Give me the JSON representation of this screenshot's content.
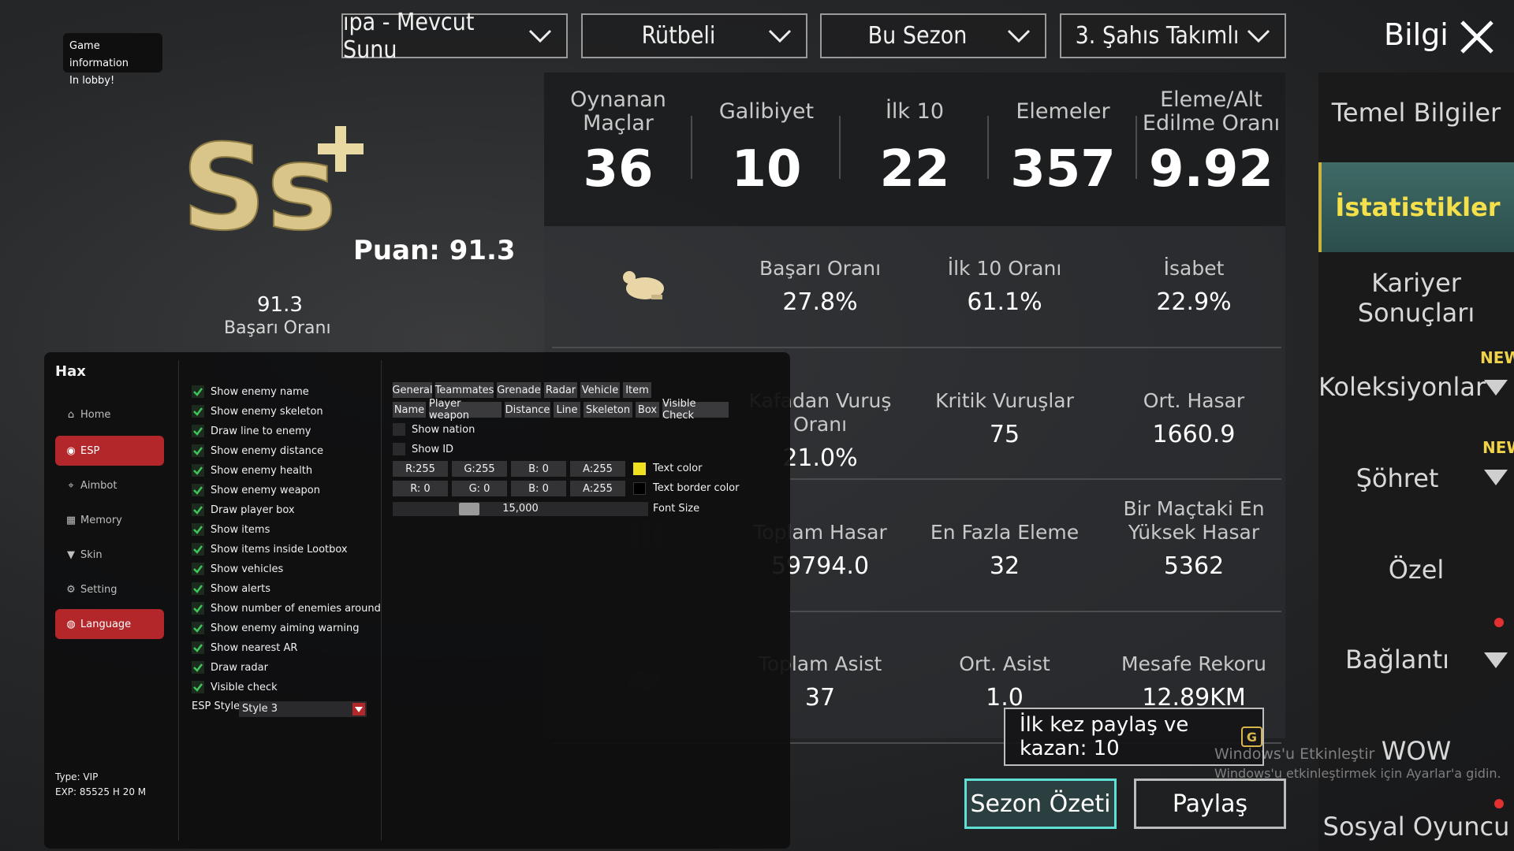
{
  "game_info": {
    "line1": "Game information",
    "line2": "In lobby!"
  },
  "dropdowns": [
    {
      "label": "ıpa - Mevcut Sunu"
    },
    {
      "label": "Rütbeli"
    },
    {
      "label": "Bu Sezon"
    },
    {
      "label": "3. Şahıs Takımlı"
    }
  ],
  "header": {
    "title": "Bilgi"
  },
  "rank": {
    "logo_text": "Ss",
    "puan": "Puan: 91.3",
    "rating_value": "91.3",
    "rating_label": "Başarı Oranı"
  },
  "top_stats": [
    {
      "label": "Oynanan Maçlar",
      "value": "36"
    },
    {
      "label": "Galibiyet",
      "value": "10"
    },
    {
      "label": "İlk 10",
      "value": "22"
    },
    {
      "label": "Elemeler",
      "value": "357"
    },
    {
      "label": "Eleme/Alt Edilme Oranı",
      "value": "9.92"
    }
  ],
  "detail_stats": [
    {
      "label": "Başarı Oranı",
      "value": "27.8%"
    },
    {
      "label": "İlk 10 Oranı",
      "value": "61.1%"
    },
    {
      "label": "İsabet",
      "value": "22.9%"
    },
    {
      "label": "Kafadan Vuruş Oranı",
      "value": "21.0%"
    },
    {
      "label": "Kritik Vuruşlar",
      "value": "75"
    },
    {
      "label": "Ort. Hasar",
      "value": "1660.9"
    },
    {
      "label": "Toplam Hasar",
      "value": "59794.0"
    },
    {
      "label": "En Fazla Eleme",
      "value": "32"
    },
    {
      "label": "Bir Maçtaki En Yüksek Hasar",
      "value": "5362"
    },
    {
      "label": "Toplam Asist",
      "value": "37"
    },
    {
      "label": "Ort. Asist",
      "value": "1.0"
    },
    {
      "label": "Mesafe Rekoru",
      "value": "12.89KM"
    }
  ],
  "sidebar": {
    "items": [
      {
        "label": "Temel Bilgiler"
      },
      {
        "label": "İstatistikler"
      },
      {
        "label": "Kariyer Sonuçları"
      },
      {
        "label": "Koleksiyonlar"
      },
      {
        "label": "Şöhret"
      },
      {
        "label": "Özel"
      },
      {
        "label": "Bağlantı"
      },
      {
        "label": "WOW"
      },
      {
        "label": "Sosyal Oyuncu"
      }
    ],
    "new_badge": "NEW"
  },
  "share": {
    "tip": "İlk kez paylaş ve kazan: 10",
    "coin": "G",
    "season_button": "Sezon Özeti",
    "share_button": "Paylaş"
  },
  "watermark": {
    "line1": "Windows'u Etkinleştir",
    "line2": "Windows'u etkinleştirmek için Ayarlar'a gidin."
  },
  "hax": {
    "title": "Hax",
    "nav": [
      {
        "label": "Home",
        "icon": "home-icon"
      },
      {
        "label": "ESP",
        "icon": "eye-icon"
      },
      {
        "label": "Aimbot",
        "icon": "crosshair-icon"
      },
      {
        "label": "Memory",
        "icon": "memory-icon"
      },
      {
        "label": "Skin",
        "icon": "shirt-icon"
      },
      {
        "label": "Setting",
        "icon": "gear-icon"
      },
      {
        "label": "Language",
        "icon": "globe-icon"
      }
    ],
    "footer": {
      "type": "Type: VIP",
      "exp": "EXP: 85525 H 20 M"
    },
    "options": [
      "Show enemy name",
      "Show enemy skeleton",
      "Draw line to enemy",
      "Show enemy distance",
      "Show enemy health",
      "Show enemy weapon",
      "Draw player box",
      "Show items",
      "Show items inside Lootbox",
      "Show vehicles",
      "Show alerts",
      "Show number of enemies around",
      "Show enemy aiming warning",
      "Show nearest AR",
      "Draw radar",
      "Visible check"
    ],
    "esp_style_label": "ESP Style",
    "esp_style_value": "Style 3",
    "tabs1": [
      "General",
      "Teammates",
      "Grenade",
      "Radar",
      "Vehicle",
      "Item"
    ],
    "tabs2": [
      "Name",
      "Player weapon",
      "Distance",
      "Line",
      "Skeleton",
      "Box",
      "Visible Check"
    ],
    "unchecked": [
      "Show nation",
      "Show ID"
    ],
    "text_color": {
      "r": "R:255",
      "g": "G:255",
      "b": "B:  0",
      "a": "A:255",
      "label": "Text color",
      "swatch": "#f0e020"
    },
    "border_color": {
      "r": "R:  0",
      "g": "G:  0",
      "b": "B:  0",
      "a": "A:255",
      "label": "Text border color",
      "swatch": "#000000"
    },
    "font_size": {
      "value": "15,000",
      "label": "Font Size"
    }
  }
}
